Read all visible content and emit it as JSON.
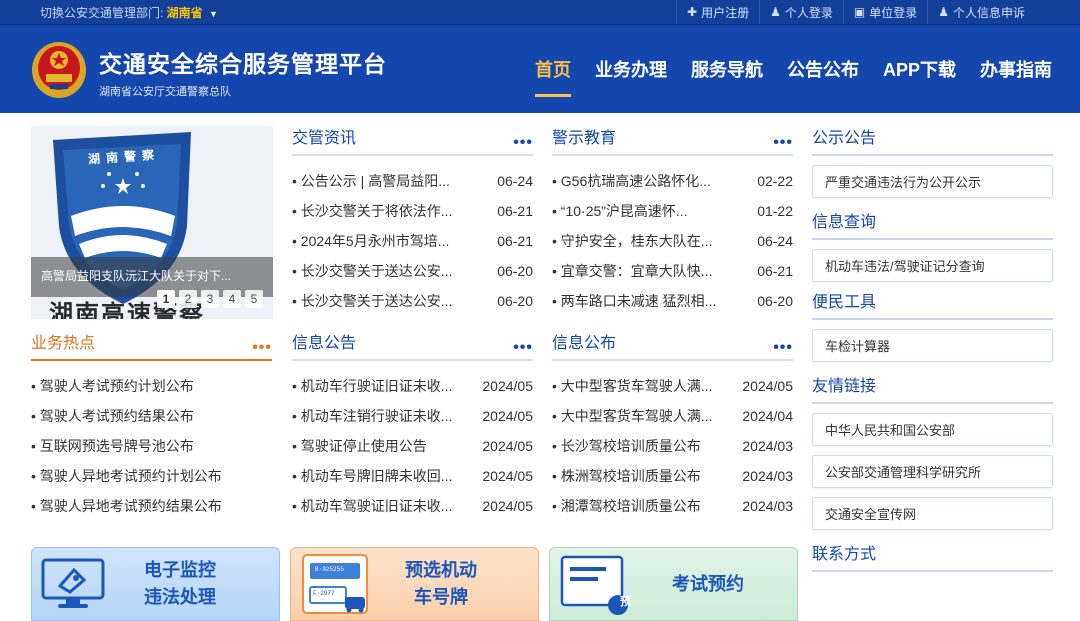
{
  "topbar": {
    "switch_label": "切换公安交通管理部门: ",
    "province": "湖南省",
    "links": [
      "用户注册",
      "个人登录",
      "单位登录",
      "个人信息申诉"
    ]
  },
  "header": {
    "title": "交通安全综合服务管理平台",
    "subtitle": "湖南省公安厅交通警察总队",
    "nav": [
      "首页",
      "业务办理",
      "服务导航",
      "公告公布",
      "APP下载",
      "办事指南"
    ]
  },
  "slider": {
    "caption": "高警局益阳支队沅江大队关于对下...",
    "overlay_text": "湖南高速警察",
    "pages": [
      "1",
      "2",
      "3",
      "4",
      "5"
    ],
    "logo_text": "湖南警察"
  },
  "sections": {
    "jiaoguan": {
      "title": "交管资讯",
      "more": "•••",
      "items": [
        {
          "text": "公告公示 | 高警局益阳...",
          "date": "06-24"
        },
        {
          "text": "长沙交警关于将依法作...",
          "date": "06-21"
        },
        {
          "text": "2024年5月永州市驾培...",
          "date": "06-21"
        },
        {
          "text": "长沙交警关于送达公安...",
          "date": "06-20"
        },
        {
          "text": "长沙交警关于送达公安...",
          "date": "06-20"
        }
      ]
    },
    "jingshi": {
      "title": "警示教育",
      "more": "•••",
      "items": [
        {
          "text": "G56杭瑞高速公路怀化...",
          "date": "02-22"
        },
        {
          "text": "“10·25”沪昆高速怀...",
          "date": "01-22"
        },
        {
          "text": "守护安全，桂东大队在...",
          "date": "06-24"
        },
        {
          "text": "宜章交警：宜章大队快...",
          "date": "06-21"
        },
        {
          "text": "两车路口未减速 猛烈相...",
          "date": "06-20"
        }
      ]
    },
    "yewu": {
      "title": "业务热点",
      "more": "•••",
      "items": [
        {
          "text": "驾驶人考试预约计划公布"
        },
        {
          "text": "驾驶人考试预约结果公布"
        },
        {
          "text": "互联网预选号牌号池公布"
        },
        {
          "text": "驾驶人异地考试预约计划公布"
        },
        {
          "text": "驾驶人异地考试预约结果公布"
        }
      ]
    },
    "xinxi_gonggao": {
      "title": "信息公告",
      "more": "•••",
      "items": [
        {
          "text": "机动车行驶证旧证未收...",
          "date": "2024/05"
        },
        {
          "text": "机动车注销行驶证未收...",
          "date": "2024/05"
        },
        {
          "text": "驾驶证停止使用公告",
          "date": "2024/05"
        },
        {
          "text": "机动车号牌旧牌未收回...",
          "date": "2024/05"
        },
        {
          "text": "机动车驾驶证旧证未收...",
          "date": "2024/05"
        }
      ]
    },
    "xinxi_gongbu": {
      "title": "信息公布",
      "more": "•••",
      "items": [
        {
          "text": "大中型客货车驾驶人满...",
          "date": "2024/05"
        },
        {
          "text": "大中型客货车驾驶人满...",
          "date": "2024/04"
        },
        {
          "text": "长沙驾校培训质量公布",
          "date": "2024/03"
        },
        {
          "text": "株洲驾校培训质量公布",
          "date": "2024/03"
        },
        {
          "text": "湘潭驾校培训质量公布",
          "date": "2024/03"
        }
      ]
    }
  },
  "right": {
    "gongshi": {
      "title": "公示公告",
      "items": [
        "严重交通违法行为公开公示"
      ]
    },
    "chaxun": {
      "title": "信息查询",
      "items": [
        "机动车违法/驾驶证记分查询"
      ]
    },
    "bianmin": {
      "title": "便民工具",
      "items": [
        "车检计算器"
      ]
    },
    "youqing": {
      "title": "友情链接",
      "items": [
        "中华人民共和国公安部",
        "公安部交通管理科学研究所",
        "交通安全宣传网"
      ]
    },
    "lianxi": {
      "title": "联系方式"
    }
  },
  "banners": {
    "b1": {
      "line1": "电子监控",
      "line2": "违法处理"
    },
    "b2": {
      "line1": "预选机动",
      "line2": "车号牌",
      "plate1": "B·925255",
      "plate2": "F·2977"
    },
    "b3": {
      "line1": "考试预约",
      "badge": "预"
    }
  },
  "colors": {
    "primary": "#1347ad",
    "accent": "#f7c14a",
    "orange": "#e8731c"
  }
}
